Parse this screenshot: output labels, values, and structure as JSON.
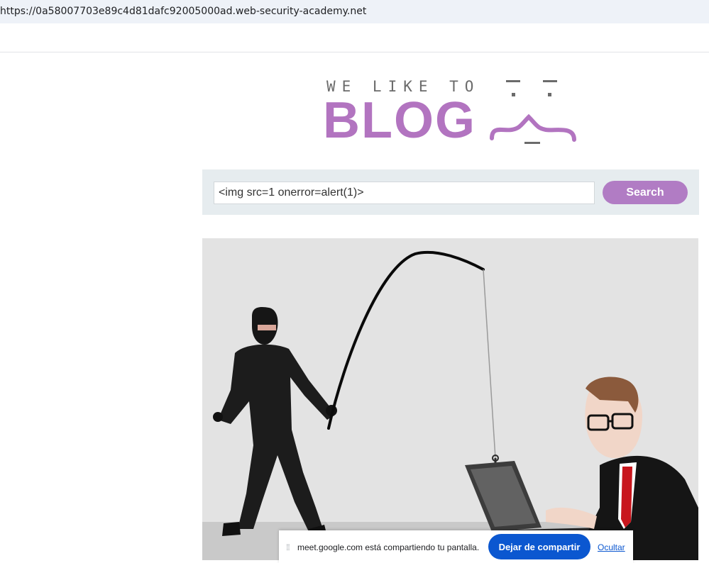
{
  "browser": {
    "url": "https://0a58007703e89c4d81dafc92005000ad.web-security-academy.net"
  },
  "logo": {
    "tagline": "WE LIKE TO",
    "wordmark": "BLOG",
    "brand_color": "#b274c0"
  },
  "search": {
    "input_value": "<img src=1 onerror=alert(1)>",
    "button_label": "Search",
    "button_color": "#b17cc4"
  },
  "hero_image": {
    "icon": "phishing-illustration"
  },
  "share_notice": {
    "message": "meet.google.com está compartiendo tu pantalla.",
    "stop_label": "Dejar de compartir",
    "hide_label": "Ocultar",
    "accent_color": "#0b57d0"
  }
}
